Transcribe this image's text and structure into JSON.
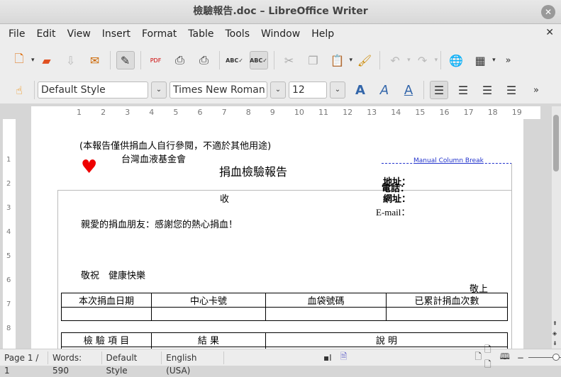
{
  "window": {
    "title": "檢驗報告.doc – LibreOffice Writer"
  },
  "menu": [
    "File",
    "Edit",
    "View",
    "Insert",
    "Format",
    "Table",
    "Tools",
    "Window",
    "Help"
  ],
  "toolbar": {
    "paragraph_style": "Default Style",
    "font_name": "Times New Roman",
    "font_size": "12"
  },
  "ruler": [
    "1",
    "2",
    "3",
    "4",
    "5",
    "6",
    "7",
    "8",
    "9",
    "10",
    "11",
    "12",
    "13",
    "14",
    "15",
    "16",
    "17",
    "18",
    "19"
  ],
  "vruler": [
    "1",
    "2",
    "3",
    "4",
    "5",
    "6",
    "7",
    "8"
  ],
  "document": {
    "notice": "(本報告僅供捐血人自行參閱，不適於其他用途)",
    "org": "台灣血液基金會",
    "title": "捐血檢驗報告",
    "column_break": "Manual Column Break",
    "address": "地址：",
    "phone": "電話：",
    "website": "網址：",
    "email": "E-mail：",
    "recipient": "收",
    "greeting": "親愛的捐血朋友：感謝您的熱心捐血！",
    "closing": "敬祝　健康快樂",
    "signoff": "敬上",
    "table1_headers": [
      "本次捐血日期",
      "中心卡號",
      "血袋號碼",
      "已累計捐血次數"
    ],
    "table2_headers": [
      "檢 驗 項 目",
      "結 果",
      "說 明"
    ]
  },
  "status": {
    "page": "Page 1 / 1",
    "words": "Words: 590",
    "style": "Default Style",
    "language": "English (USA)"
  }
}
